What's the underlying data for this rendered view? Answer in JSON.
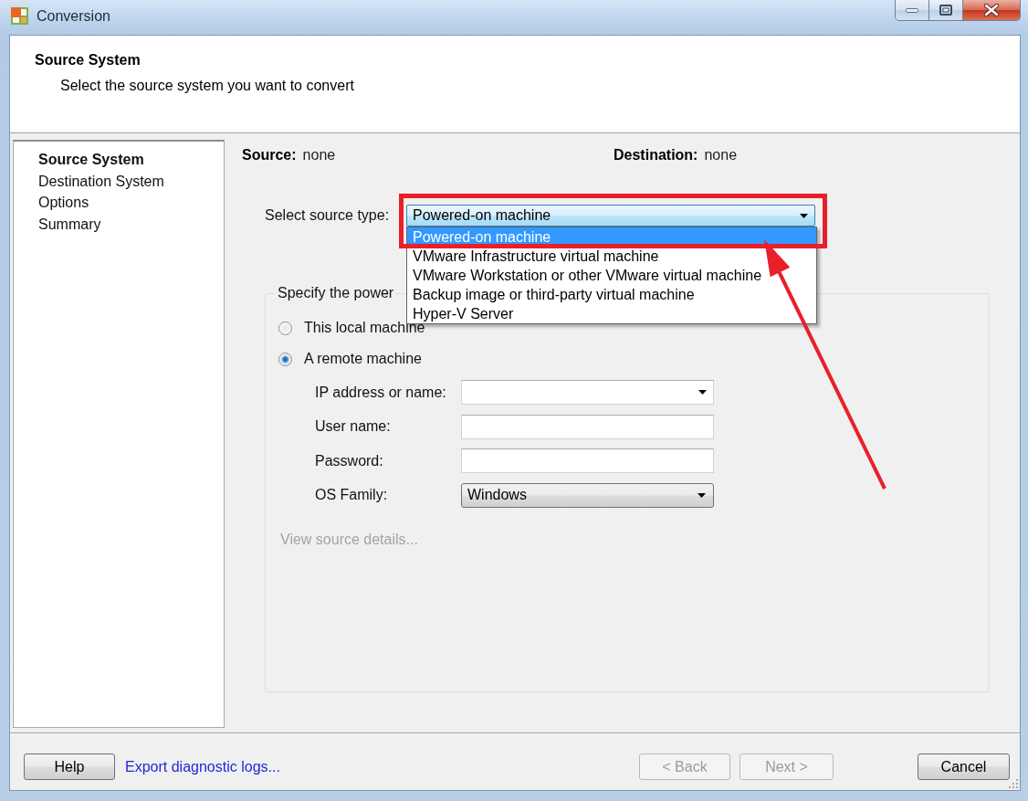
{
  "window": {
    "title": "Conversion"
  },
  "header": {
    "title": "Source System",
    "subtitle": "Select the source system you want to convert"
  },
  "sidebar": {
    "items": [
      {
        "label": "Source System",
        "selected": true
      },
      {
        "label": "Destination System",
        "selected": false
      },
      {
        "label": "Options",
        "selected": false
      },
      {
        "label": "Summary",
        "selected": false
      }
    ]
  },
  "summary": {
    "source": {
      "label": "Source:",
      "value": "none"
    },
    "destination": {
      "label": "Destination:",
      "value": "none"
    }
  },
  "source_type": {
    "label": "Select source type:",
    "value": "Powered-on machine",
    "expanded": true,
    "options": [
      {
        "label": "Powered-on machine",
        "selected": true
      },
      {
        "label": "VMware Infrastructure virtual machine",
        "selected": false
      },
      {
        "label": "VMware Workstation or other VMware virtual machine",
        "selected": false
      },
      {
        "label": "Backup image or third-party virtual machine",
        "selected": false
      },
      {
        "label": "Hyper-V Server",
        "selected": false
      }
    ]
  },
  "group": {
    "title": "Specify the power",
    "radios": [
      {
        "label": "This local machine",
        "checked": false
      },
      {
        "label": "A remote machine",
        "checked": true
      }
    ],
    "fields": [
      {
        "label": "IP address or name:",
        "kind": "combo"
      },
      {
        "label": "User name:",
        "kind": "text"
      },
      {
        "label": "Password:",
        "kind": "text"
      },
      {
        "label": "OS Family:",
        "kind": "select",
        "value": "Windows"
      }
    ],
    "details_link": {
      "label": "View source details...",
      "disabled": true
    }
  },
  "footer": {
    "help_button": {
      "label": "Help"
    },
    "link": {
      "label": "Export diagnostic logs..."
    },
    "nav_buttons": [
      {
        "label": "< Back",
        "disabled": true
      },
      {
        "label": "Next >",
        "disabled": true
      }
    ],
    "cancel_button": {
      "label": "Cancel"
    }
  },
  "annotations": {
    "highlight_box": true,
    "arrow": true
  }
}
